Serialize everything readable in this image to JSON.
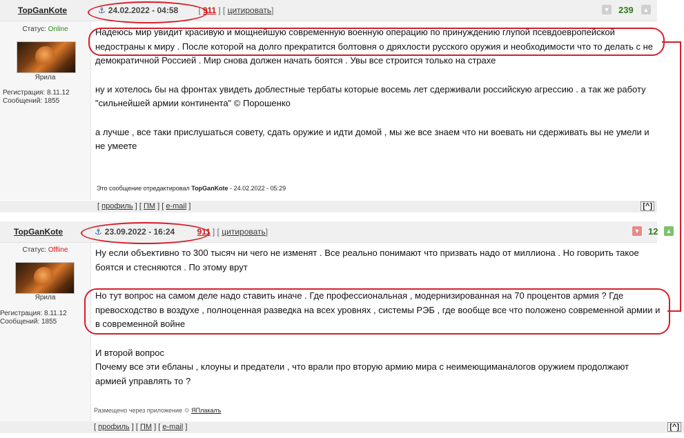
{
  "posts": [
    {
      "author": "TopGanKote",
      "anchor_icon": "anchor-icon",
      "date": "24.02.2022 - 04:58",
      "post_number": "911",
      "quote_label": "цитировать",
      "rating": "239",
      "status_label": "Статус:",
      "status_value": "Online",
      "user_title": "Ярила",
      "registration": "Регистрация: 8.11.12",
      "messages": "Сообщений: 1855",
      "paragraphs": [
        "Надеюсь мир увидит красивую и мощнейшую современную военную операцию по принуждению глупой псевдоевропейской недостраны к миру . После которой на долго прекратится болтовня о дряхлости русского оружия и необходимости что то делать с не демократичной Россией . Мир снова должен начать боятся . Увы все строится только на страхе",
        "ну и хотелось бы на фронтах увидеть доблестные тербаты которые восемь лет сдерживали российскую агрессию . а так же работу \"сильнейшей армии континента\" © Порошенко",
        "а лучше , все таки прислушаться совету, сдать оружие и идти домой , мы же все знаем что ни воевать ни сдерживать вы не умели и не умеете"
      ],
      "edited_prefix": "Это сообщение отредактировал",
      "edited_author": "TopGanKote",
      "edited_date": "- 24.02.2022 - 05:29",
      "footer": {
        "profile": "профиль",
        "pm": "ПМ",
        "email": "e-mail",
        "up": "[^]"
      }
    },
    {
      "author": "TopGanKote",
      "anchor_icon": "anchor-icon",
      "date": "23.09.2022 - 16:24",
      "post_number": "911",
      "quote_label": "цитировать",
      "rating": "12",
      "status_label": "Статус:",
      "status_value": "Offline",
      "user_title": "Ярила",
      "registration": "Регистрация: 8.11.12",
      "messages": "Сообщений: 1855",
      "paragraphs": [
        "Ну если объективно то 300 тысяч ни чего не изменят . Все реально понимают что призвать надо от миллиона . Но говорить такое боятся и стесняются . По этому врут",
        "Но тут вопрос на самом деле надо ставить иначе . Где профессиональная , модернизированная на 70 процентов армия ? Где превосходство в воздухе , полноценная разведка на всех уровнях , системы РЭБ , где вообще все что положено современной армии и в современной войне",
        "И второй вопрос\nПочему все эти ебланы , клоуны и предатели , что врали про вторую армию мира с неимеющиманалогов оружием продолжают армией управлять то ?"
      ],
      "posted_via": "Размещено через приложение",
      "app_name": "ЯПлакалъ",
      "footer": {
        "profile": "профиль",
        "pm": "ПМ",
        "email": "e-mail",
        "up": "[^]"
      }
    }
  ],
  "colors": {
    "accent_red": "#d41e2a",
    "rating_green": "#2e7d1c",
    "online_green": "#2e8a1c",
    "offline_red": "#d41515"
  }
}
